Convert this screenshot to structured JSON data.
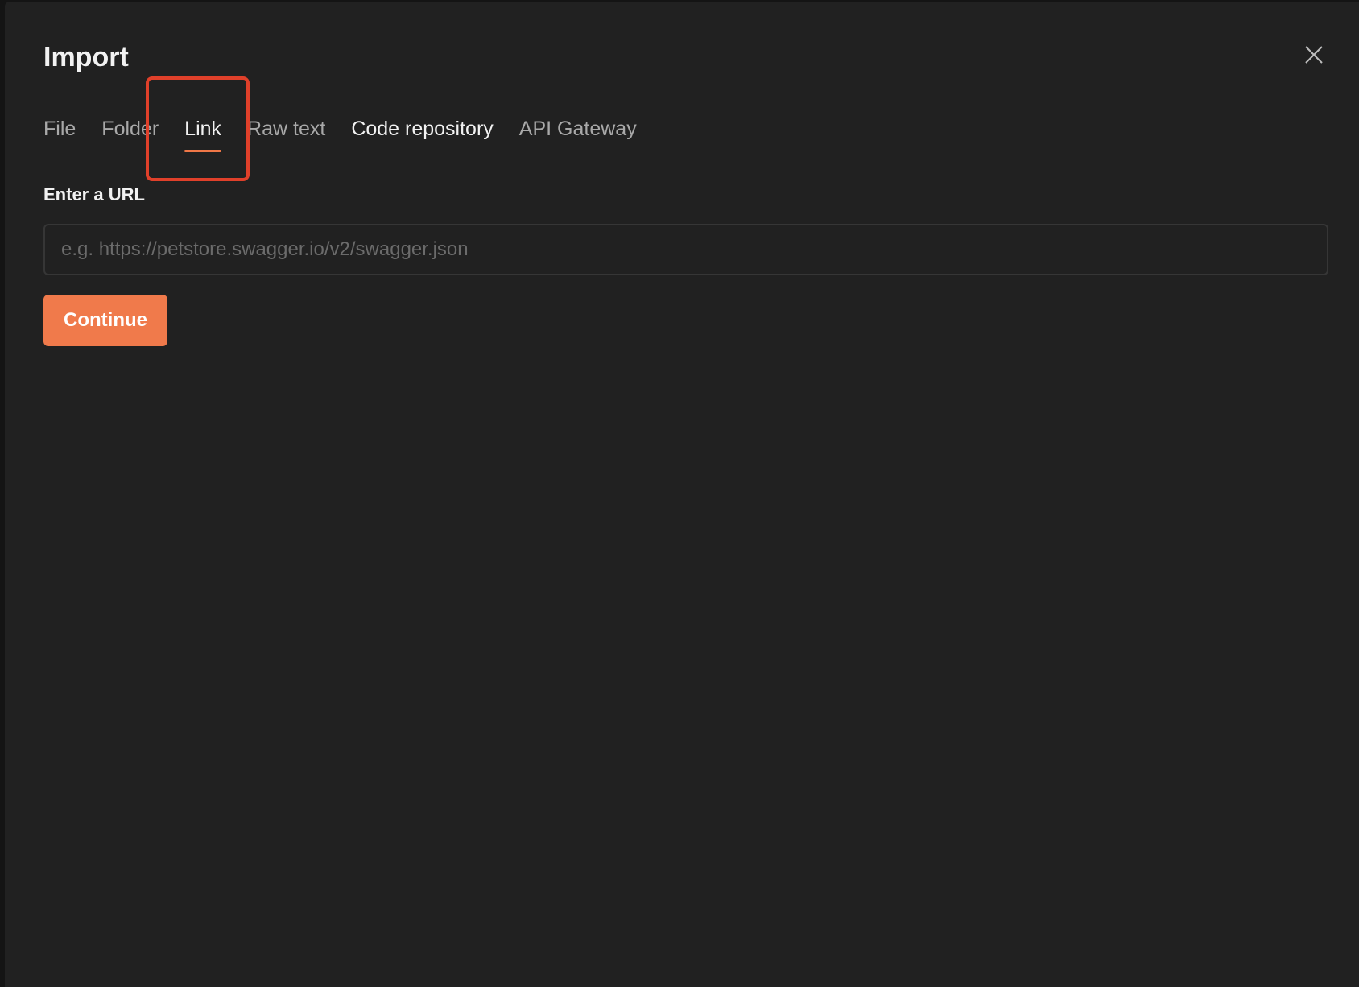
{
  "dialog": {
    "title": "Import",
    "close_icon": "close-icon"
  },
  "tabs": [
    {
      "label": "File",
      "active": false
    },
    {
      "label": "Folder",
      "active": false
    },
    {
      "label": "Link",
      "active": true
    },
    {
      "label": "Raw text",
      "active": false
    },
    {
      "label": "Code repository",
      "active": false
    },
    {
      "label": "API Gateway",
      "active": false
    }
  ],
  "form": {
    "label": "Enter a URL",
    "value": "",
    "placeholder": "e.g. https://petstore.swagger.io/v2/swagger.json",
    "submit_label": "Continue"
  },
  "colors": {
    "background": "#212121",
    "accent": "#f07a4b",
    "highlight": "#e0402a"
  }
}
